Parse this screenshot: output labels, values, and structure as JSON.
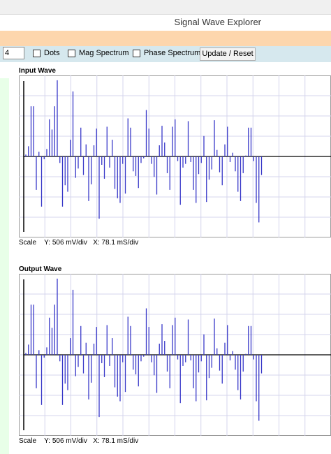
{
  "app": {
    "title": "Signal Wave Explorer"
  },
  "toolbar": {
    "count_value": "4",
    "dots_label": "Dots",
    "mag_label": "Mag Spectrum",
    "phase_label": "Phase Spectrum",
    "update_label": "Update / Reset",
    "dots_checked": false,
    "mag_checked": false,
    "phase_checked": false
  },
  "colors": {
    "trace": "#3838c8",
    "grid": "#d4d4ec",
    "axis": "#000000",
    "toolbar": "#d6e8ee",
    "banner": "#fdd6ad"
  },
  "input_section": {
    "title": "Input Wave",
    "scale_label": "Scale",
    "y_scale": "Y: 506 mV/div",
    "x_scale": "X: 78.1 mS/div"
  },
  "output_section": {
    "title": "Output Wave",
    "scale_label": "Scale",
    "y_scale": "Y: 506 mV/div",
    "x_scale": "X: 78.1 mS/div"
  },
  "chart_data": [
    {
      "type": "bar",
      "name": "input-wave",
      "title": "Input Wave",
      "x_divisions": 12,
      "y_divisions": 8,
      "ylim": [
        -4,
        4
      ],
      "grid": true,
      "values": [
        0.2,
        1.1,
        5.4,
        5.4,
        -3.6,
        0.5,
        -5.4,
        -0.3,
        0.8,
        4.0,
        2.9,
        5.4,
        8.2,
        -0.7,
        -5.4,
        -3.1,
        -3.8,
        1.8,
        7.0,
        -2.3,
        -1.3,
        3.1,
        -2.0,
        1.3,
        -4.8,
        -3.0,
        1.2,
        3.0,
        -6.7,
        -0.9,
        -2.4,
        3.2,
        -1.2,
        1.8,
        -3.5,
        -4.5,
        -5.0,
        -0.8,
        -4.0,
        4.1,
        3.1,
        -1.6,
        -2.1,
        -3.4,
        -0.7,
        -0.2,
        5.0,
        3.0,
        -0.8,
        -2.2,
        -4.1,
        1.2,
        3.3,
        1.5,
        -1.8,
        -3.6,
        3.2,
        4.0,
        -0.5,
        -5.2,
        -1.2,
        -0.8,
        3.8,
        -0.6,
        -3.6,
        -5.0,
        -1.9,
        -0.7,
        2.2,
        -4.9,
        -2.5,
        -1.4,
        3.9,
        0.7,
        -1.7,
        -3.1,
        1.3,
        3.2,
        -0.6,
        0.4,
        -1.6,
        -3.8,
        -4.8,
        -1.8,
        0.1,
        3.1,
        3.1,
        -0.5,
        -5.0,
        -7.1,
        -2.0
      ]
    },
    {
      "type": "bar",
      "name": "output-wave",
      "title": "Output Wave",
      "x_divisions": 12,
      "y_divisions": 8,
      "ylim": [
        -4,
        4
      ],
      "grid": true,
      "values": [
        0.2,
        1.1,
        5.4,
        5.4,
        -3.6,
        0.5,
        -5.4,
        -0.3,
        0.8,
        4.0,
        2.9,
        5.4,
        8.2,
        -0.7,
        -5.4,
        -3.1,
        -3.8,
        1.8,
        7.0,
        -2.3,
        -1.3,
        3.1,
        -2.0,
        1.3,
        -4.8,
        -3.0,
        1.2,
        3.0,
        -6.7,
        -0.9,
        -2.4,
        3.2,
        -1.2,
        1.8,
        -3.5,
        -4.5,
        -5.0,
        -0.8,
        -4.0,
        4.1,
        3.1,
        -1.6,
        -2.1,
        -3.4,
        -0.7,
        -0.2,
        5.0,
        3.0,
        -0.8,
        -2.2,
        -4.1,
        1.2,
        3.3,
        1.5,
        -1.8,
        -3.6,
        3.2,
        4.0,
        -0.5,
        -5.2,
        -1.2,
        -0.8,
        3.8,
        -0.6,
        -3.6,
        -5.0,
        -1.9,
        -0.7,
        2.2,
        -4.9,
        -2.5,
        -1.4,
        3.9,
        0.7,
        -1.7,
        -3.1,
        1.3,
        3.2,
        -0.6,
        0.4,
        -1.6,
        -3.8,
        -4.8,
        -1.8,
        0.1,
        3.1,
        3.1,
        -0.5,
        -5.0,
        -7.1,
        -2.0
      ]
    }
  ]
}
